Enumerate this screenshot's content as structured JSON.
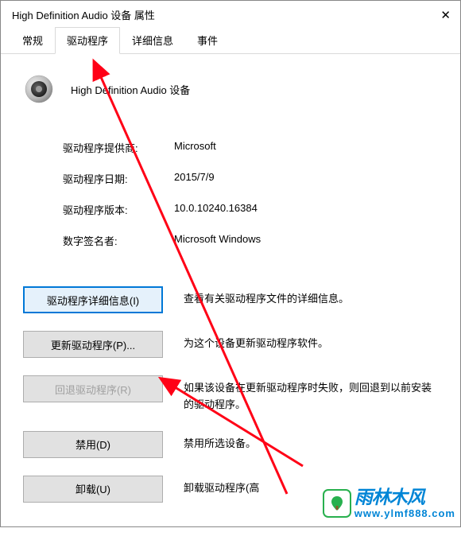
{
  "window": {
    "title": "High Definition Audio 设备 属性"
  },
  "tabs": {
    "general": "常规",
    "driver": "驱动程序",
    "details": "详细信息",
    "events": "事件"
  },
  "device": {
    "title": "High Definition Audio 设备"
  },
  "info": {
    "provider_label": "驱动程序提供商:",
    "provider_value": "Microsoft",
    "date_label": "驱动程序日期:",
    "date_value": "2015/7/9",
    "version_label": "驱动程序版本:",
    "version_value": "10.0.10240.16384",
    "signer_label": "数字签名者:",
    "signer_value": "Microsoft Windows"
  },
  "buttons": {
    "details_label": "驱动程序详细信息(I)",
    "details_desc": "查看有关驱动程序文件的详细信息。",
    "update_label": "更新驱动程序(P)...",
    "update_desc": "为这个设备更新驱动程序软件。",
    "rollback_label": "回退驱动程序(R)",
    "rollback_desc": "如果该设备在更新驱动程序时失败，则回退到以前安装的驱动程序。",
    "disable_label": "禁用(D)",
    "disable_desc": "禁用所选设备。",
    "uninstall_label": "卸载(U)",
    "uninstall_desc": "卸载驱动程序(高"
  },
  "watermark": {
    "name": "雨林木风",
    "url": "www.ylmf888.com"
  }
}
